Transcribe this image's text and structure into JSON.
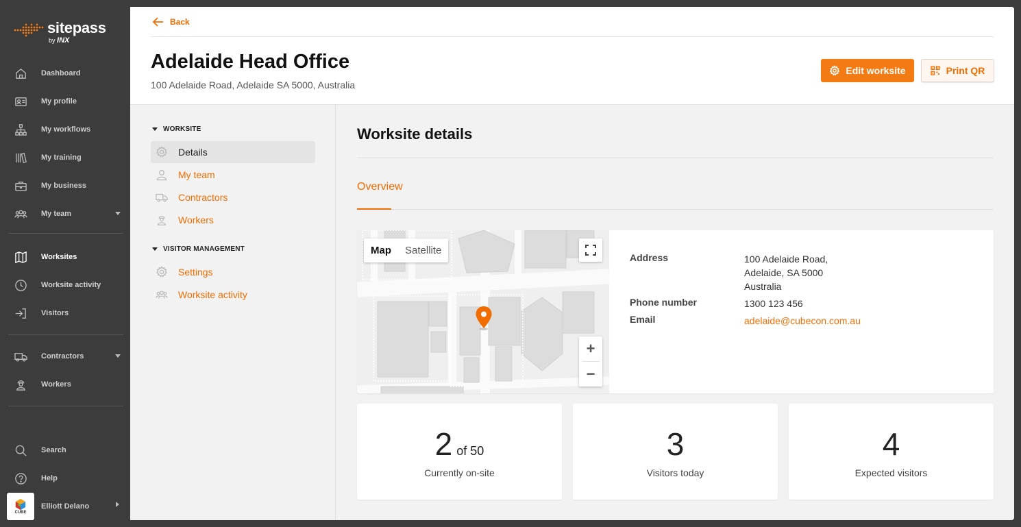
{
  "brand": {
    "name": "sitepass",
    "by": "by",
    "by_brand": "INX"
  },
  "sidebar": {
    "items": [
      {
        "label": "Dashboard"
      },
      {
        "label": "My profile"
      },
      {
        "label": "My workflows"
      },
      {
        "label": "My training"
      },
      {
        "label": "My business"
      },
      {
        "label": "My team"
      },
      {
        "label": "Worksites"
      },
      {
        "label": "Worksite activity"
      },
      {
        "label": "Visitors"
      },
      {
        "label": "Contractors"
      },
      {
        "label": "Workers"
      },
      {
        "label": "Search"
      },
      {
        "label": "Help"
      }
    ],
    "user": {
      "name": "Elliott Delano",
      "avatar_text": "CUBE"
    }
  },
  "header": {
    "back_label": "Back",
    "title": "Adelaide Head Office",
    "subtitle": "100 Adelaide Road, Adelaide SA 5000, Australia",
    "edit_label": "Edit worksite",
    "print_label": "Print QR"
  },
  "subnav": {
    "worksite_heading": "WORKSITE",
    "worksite_items": [
      {
        "label": "Details"
      },
      {
        "label": "My team"
      },
      {
        "label": "Contractors"
      },
      {
        "label": "Workers"
      }
    ],
    "visitor_heading": "VISITOR MANAGEMENT",
    "visitor_items": [
      {
        "label": "Settings"
      },
      {
        "label": "Worksite activity"
      }
    ]
  },
  "content": {
    "title": "Worksite details",
    "tab": "Overview",
    "map": {
      "map_label": "Map",
      "satellite_label": "Satellite",
      "zoom_in": "+",
      "zoom_out": "−"
    },
    "details": {
      "address_label": "Address",
      "address_lines": [
        "100 Adelaide Road,",
        "Adelaide, SA 5000",
        "Australia"
      ],
      "phone_label": "Phone number",
      "phone": "1300 123 456",
      "email_label": "Email",
      "email": "adelaide@cubecon.com.au"
    },
    "stats": [
      {
        "value": "2",
        "suffix": "of 50",
        "caption": "Currently on-site"
      },
      {
        "value": "3",
        "caption": "Visitors today"
      },
      {
        "value": "4",
        "caption": "Expected visitors"
      }
    ]
  },
  "colors": {
    "accent": "#f26d00",
    "sidebar_bg": "#3c3c3c",
    "panel_bg": "#f2f2f2"
  }
}
